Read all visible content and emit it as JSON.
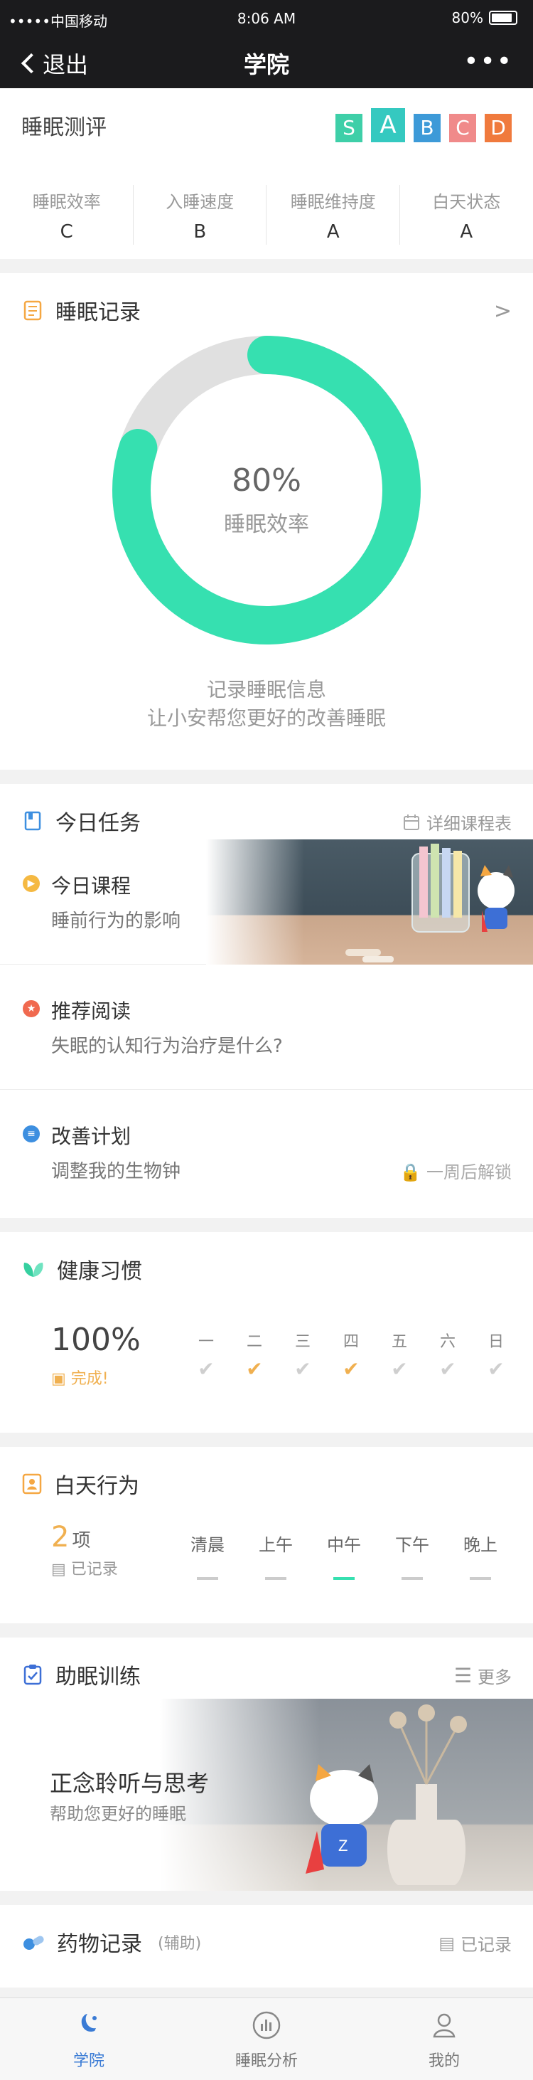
{
  "status": {
    "carrier": "•••••中国移动",
    "time": "8:06 AM",
    "battery": "80%"
  },
  "nav": {
    "back": "退出",
    "title": "学院",
    "more": "•••"
  },
  "grade": {
    "title": "睡眠测评",
    "badges": [
      {
        "label": "S",
        "color": "#3ecfa8",
        "selected": false
      },
      {
        "label": "A",
        "color": "#35c9c0",
        "selected": true
      },
      {
        "label": "B",
        "color": "#3d9ad8",
        "selected": false
      },
      {
        "label": "C",
        "color": "#f08a8a",
        "selected": false
      },
      {
        "label": "D",
        "color": "#f07a3d",
        "selected": false
      }
    ],
    "metrics": [
      {
        "label": "睡眠效率",
        "value": "C"
      },
      {
        "label": "入睡速度",
        "value": "B"
      },
      {
        "label": "睡眠维持度",
        "value": "A"
      },
      {
        "label": "白天状态",
        "value": "A"
      }
    ]
  },
  "sleep": {
    "title": "睡眠记录",
    "more": ">",
    "efficiency": 0.8,
    "percent": "80%",
    "percent_label": "睡眠效率",
    "note_line1": "记录睡眠信息",
    "note_line2": "让小安帮您更好的改善睡眠",
    "accent": "#36e0b0",
    "track": "#e0e0e0"
  },
  "tasks": {
    "title": "今日任务",
    "schedule": "详细课程表",
    "items": [
      {
        "title": "今日课程",
        "sub": "睡前行为的影响",
        "icon": "play-icon",
        "color": "#f5b942"
      },
      {
        "title": "推荐阅读",
        "sub": "失眠的认知行为治疗是什么?",
        "icon": "star-icon",
        "color": "#f0694f"
      },
      {
        "title": "改善计划",
        "sub": "调整我的生物钟",
        "icon": "list-icon",
        "color": "#3d8fe0"
      }
    ],
    "lock_text": "一周后解锁"
  },
  "habits": {
    "title": "健康习惯",
    "percent": "100%",
    "done": "完成!",
    "days": [
      {
        "d": "一",
        "done": false
      },
      {
        "d": "二",
        "done": true
      },
      {
        "d": "三",
        "done": false
      },
      {
        "d": "四",
        "done": true
      },
      {
        "d": "五",
        "done": false
      },
      {
        "d": "六",
        "done": false
      },
      {
        "d": "日",
        "done": false
      }
    ]
  },
  "behavior": {
    "title": "白天行为",
    "count": "2",
    "unit": "项",
    "recorded": "已记录",
    "periods": [
      {
        "p": "清晨",
        "active": false
      },
      {
        "p": "上午",
        "active": false
      },
      {
        "p": "中午",
        "active": true
      },
      {
        "p": "下午",
        "active": false
      },
      {
        "p": "晚上",
        "active": false
      }
    ]
  },
  "training": {
    "title": "助眠训练",
    "more": "更多",
    "card_title": "正念聆听与思考",
    "card_sub": "帮助您更好的睡眠"
  },
  "medication": {
    "title": "药物记录",
    "sub": "(辅助)",
    "recorded": "已记录"
  },
  "tabs": [
    {
      "label": "学院",
      "icon": "moon-star-icon",
      "active": true
    },
    {
      "label": "睡眠分析",
      "icon": "analysis-icon",
      "active": false
    },
    {
      "label": "我的",
      "icon": "user-icon",
      "active": false
    }
  ]
}
